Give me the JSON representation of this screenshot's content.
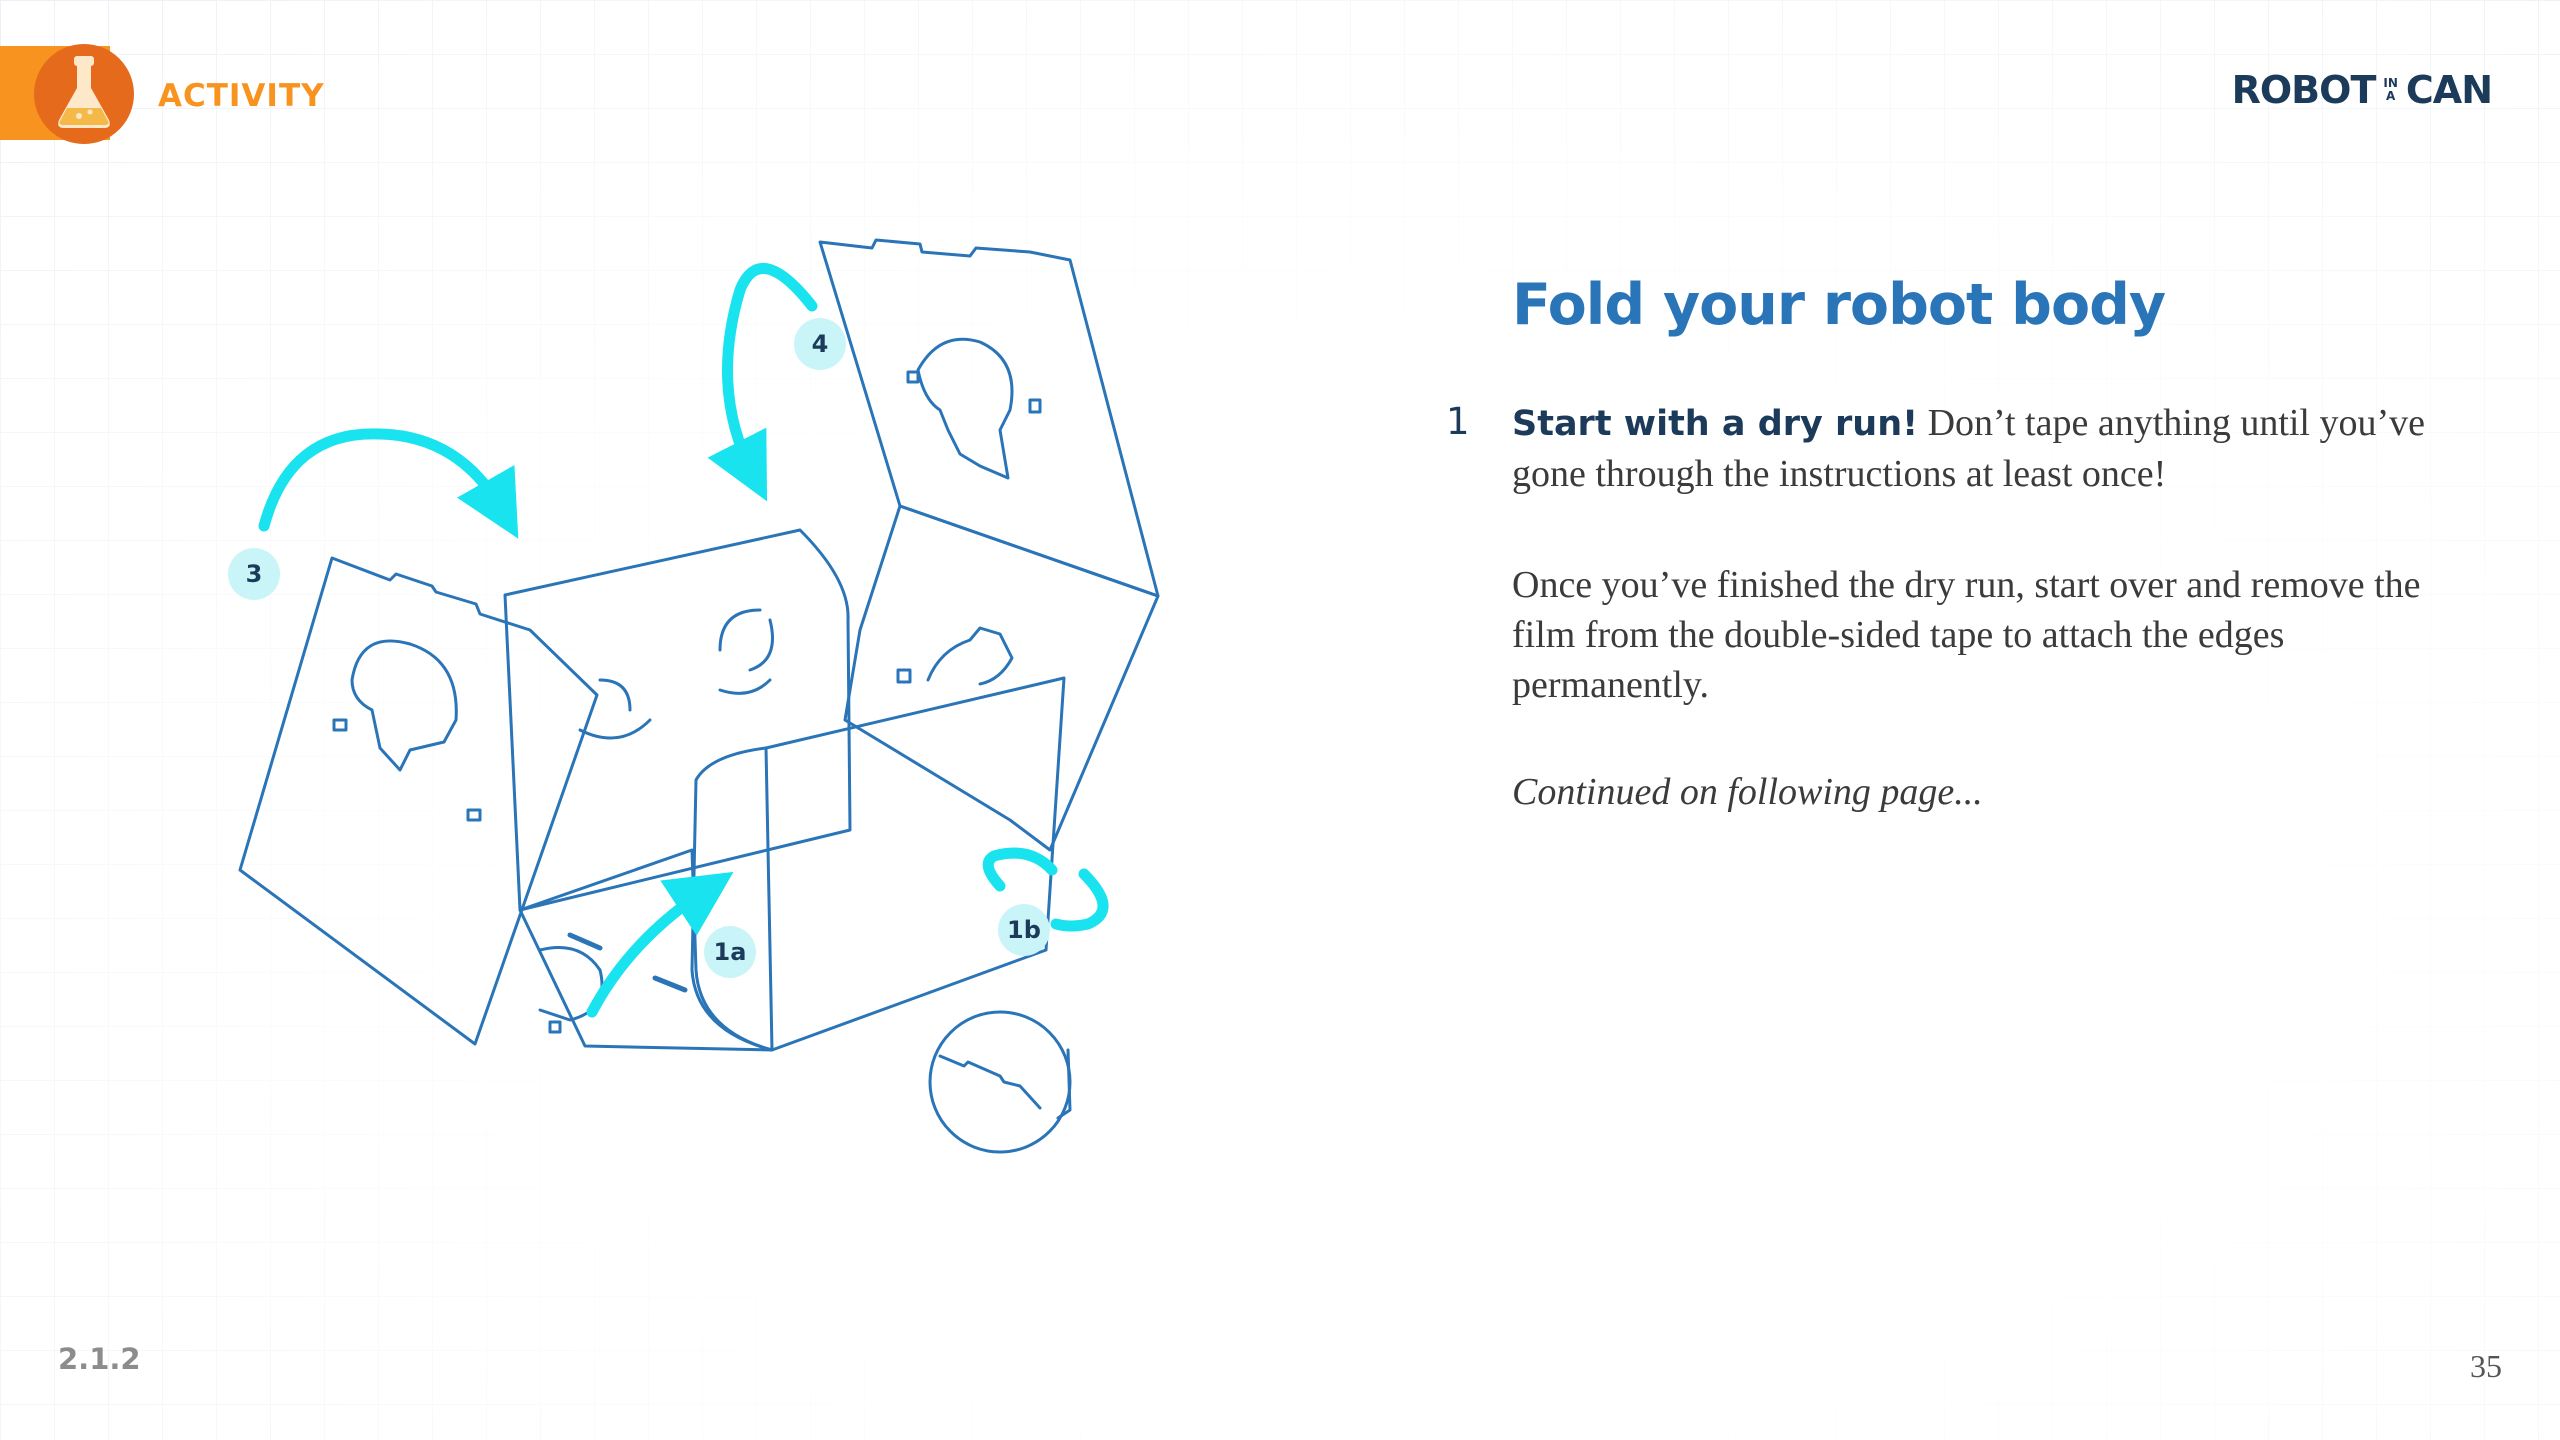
{
  "header": {
    "activity_label": "ACTIVITY",
    "activity_icon": "flask-icon",
    "brand_left": "ROBOT",
    "brand_small_top": "IN",
    "brand_small_bottom": "A",
    "brand_right": "CAN"
  },
  "illustration": {
    "labels": {
      "step_4": "4",
      "step_3": "3",
      "step_1a": "1a",
      "step_1b": "1b"
    },
    "colors": {
      "line": "#2a74b8",
      "arrow": "#19e3ef",
      "badge": "#c9f5f8"
    }
  },
  "content": {
    "title": "Fold your robot body",
    "step_number": "1",
    "step_lead": "Start with a dry run!",
    "step_text": " Don’t tape anything until you’ve gone through the instructions at least once!",
    "paragraph": "Once you’ve finished the dry run, start over and remove the film from the double-sided tape to attach the edges permanently.",
    "continued": "Continued on following page..."
  },
  "footer": {
    "section": "2.1.2",
    "page_number": "35"
  }
}
